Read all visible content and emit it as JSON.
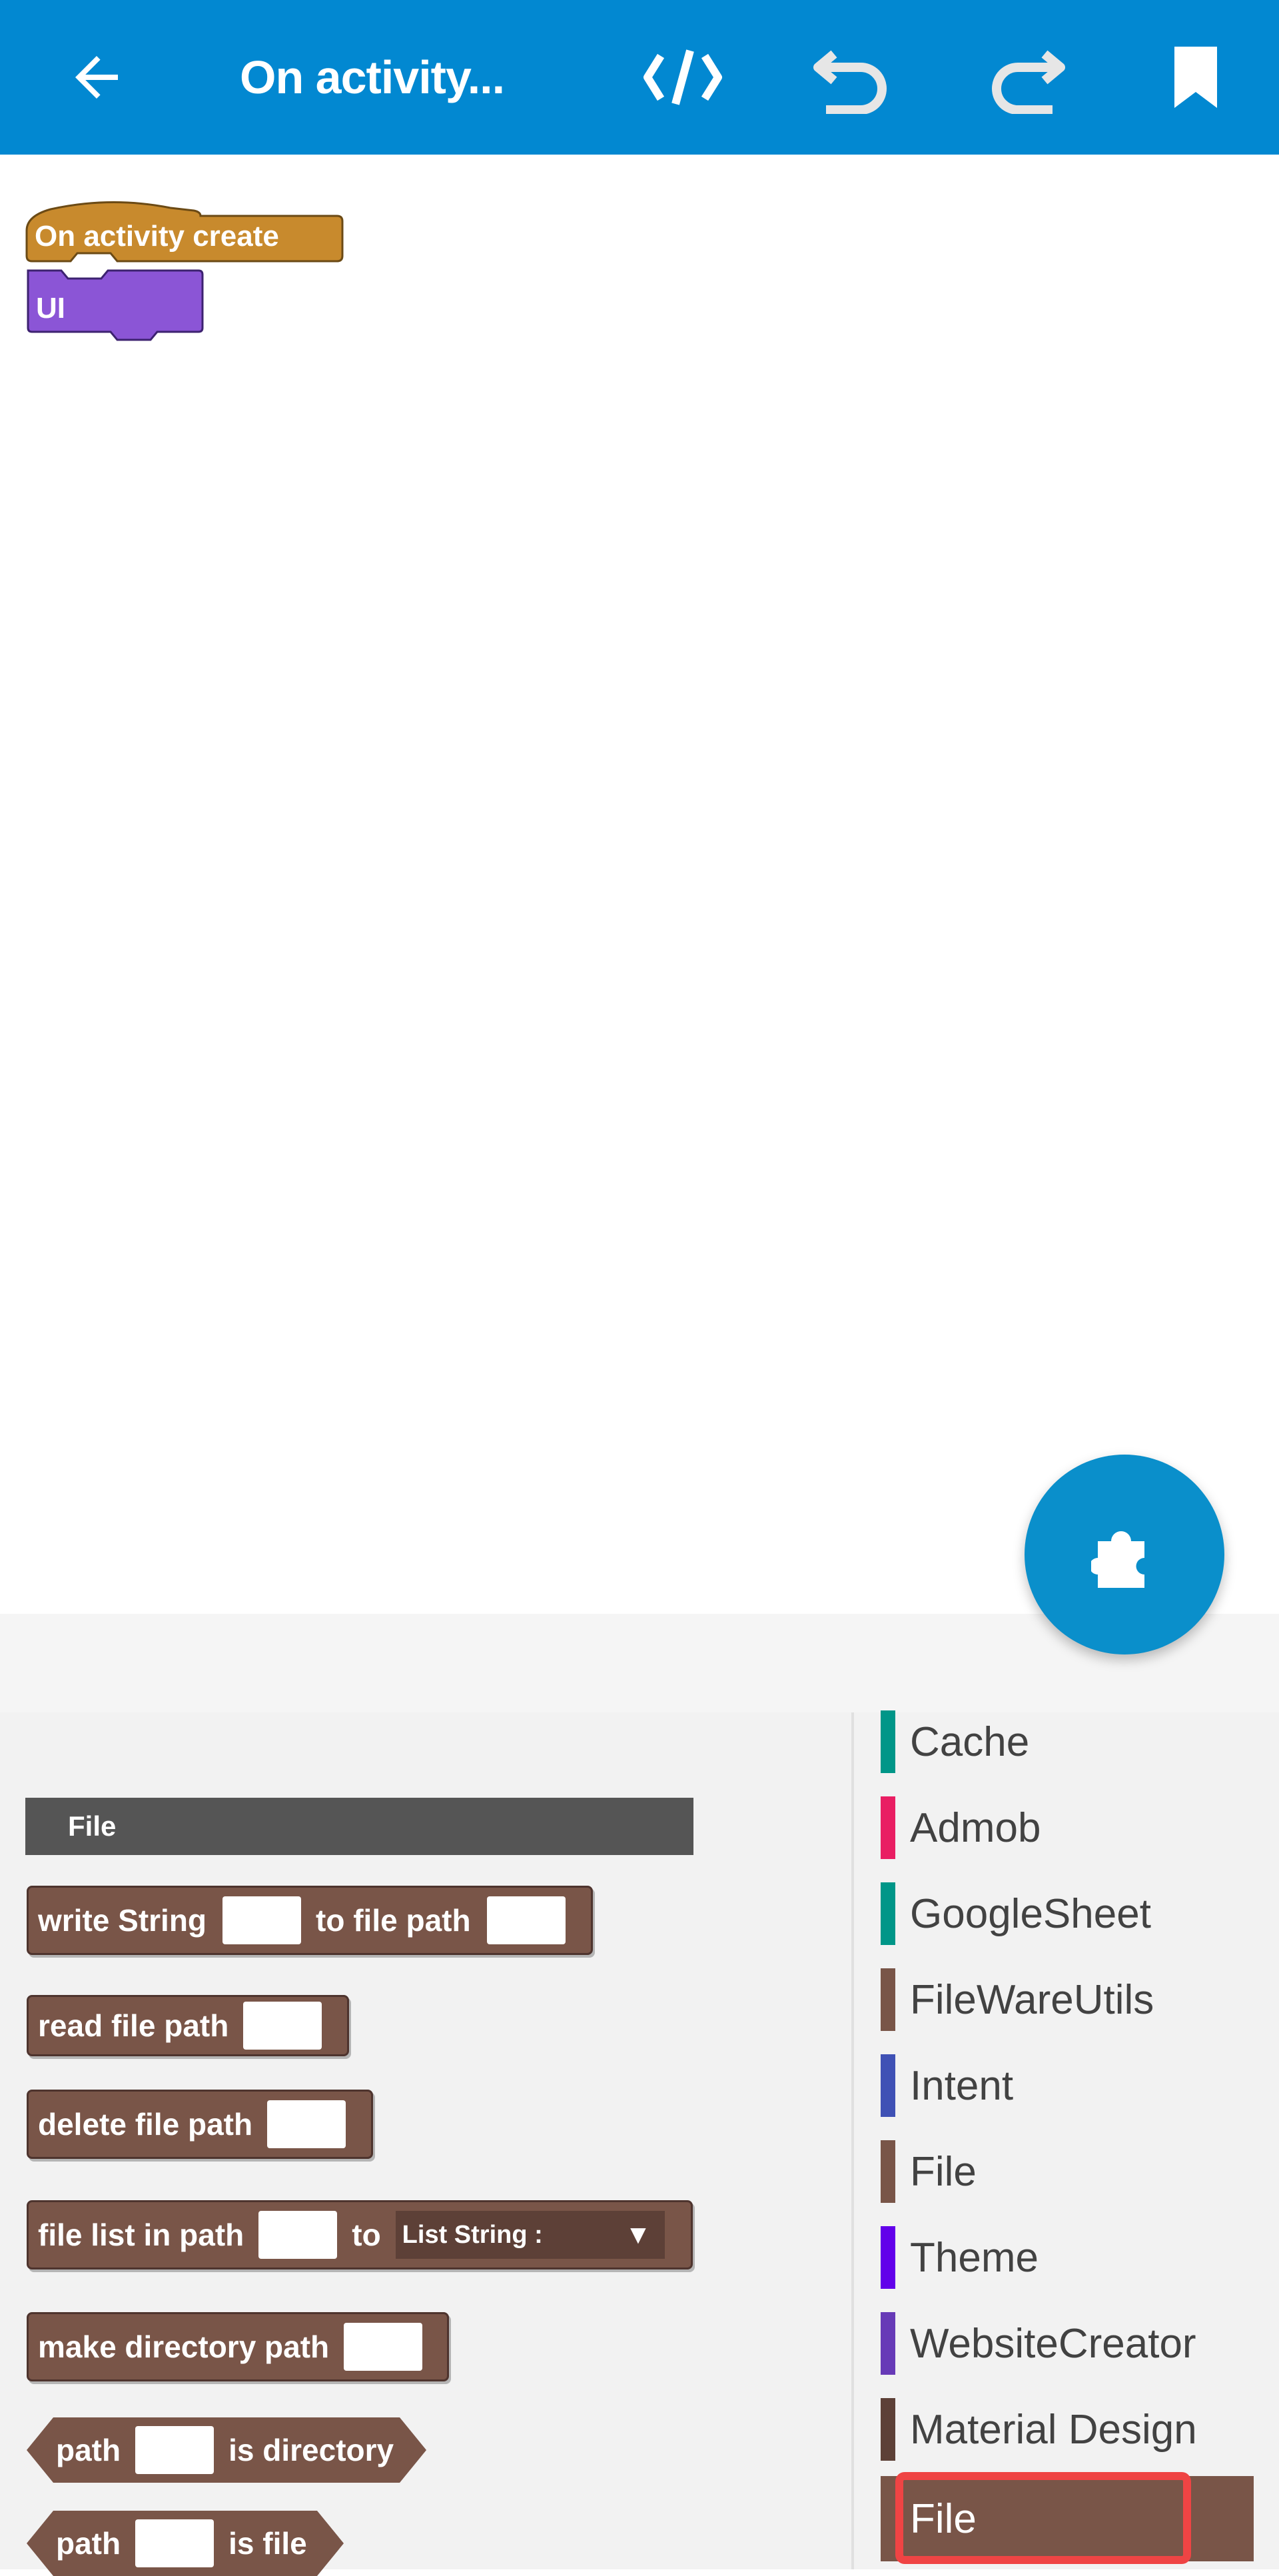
{
  "topbar": {
    "title": "On activity...",
    "background": "#0288D1",
    "icons": [
      "back-arrow-icon",
      "code-icon",
      "undo-icon",
      "redo-icon",
      "bookmark-icon"
    ]
  },
  "canvas": {
    "event_block": {
      "label": "On activity create",
      "color": "#C88A2D"
    },
    "ui_block": {
      "label": "UI",
      "color": "#8B55D6"
    },
    "fab_icon": "puzzle-icon"
  },
  "palette": {
    "header": "File",
    "blocks": {
      "write": {
        "part1": "write String",
        "part2": "to file path"
      },
      "read": {
        "part1": "read file path"
      },
      "delete": {
        "part1": "delete file path"
      },
      "filelist": {
        "part1": "file list in path",
        "part2": "to",
        "dropdown": "List String :"
      },
      "mkdir": {
        "part1": "make directory path"
      },
      "isdir": {
        "part1": "path",
        "part2": "is directory"
      },
      "isfile": {
        "part1": "path",
        "part2": "is file"
      }
    },
    "block_color": "#795548"
  },
  "categories": [
    {
      "label": "Cache",
      "color": "#009688"
    },
    {
      "label": "Admob",
      "color": "#E91E63"
    },
    {
      "label": "GoogleSheet",
      "color": "#009688"
    },
    {
      "label": "FileWareUtils",
      "color": "#795548"
    },
    {
      "label": "Intent",
      "color": "#3F51B5"
    },
    {
      "label": "File",
      "color": "#795548"
    },
    {
      "label": "Theme",
      "color": "#6200EA"
    },
    {
      "label": "WebsiteCreator",
      "color": "#673AB7"
    },
    {
      "label": "Material Design",
      "color": "#5D4037"
    },
    {
      "label": "File",
      "color": "#795548",
      "selected": true
    }
  ]
}
